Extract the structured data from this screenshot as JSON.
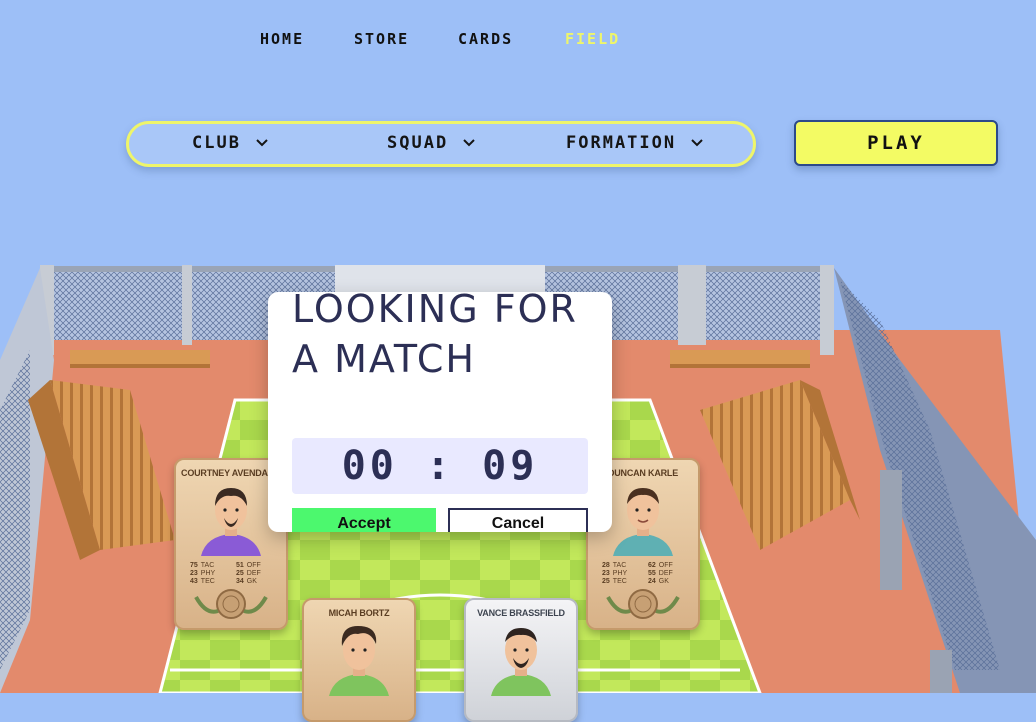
{
  "nav": {
    "items": [
      {
        "label": "HOME",
        "active": false
      },
      {
        "label": "STORE",
        "active": false
      },
      {
        "label": "CARDS",
        "active": false
      },
      {
        "label": "FIELD",
        "active": true
      }
    ]
  },
  "selectors": {
    "club": "CLUB",
    "squad": "SQUAD",
    "formation": "FORMATION"
  },
  "play_label": "PLAY",
  "modal": {
    "title": "LOOKING FOR A MATCH",
    "timer": "00 : 09",
    "accept_label": "Accept",
    "cancel_label": "Cancel"
  },
  "cards": [
    {
      "name": "COURTNEY AVENDANO",
      "tier": "bronze",
      "shirt": "#8a5bd6",
      "stats": [
        {
          "value": "75",
          "label": "TAC"
        },
        {
          "value": "51",
          "label": "OFF"
        },
        {
          "value": "23",
          "label": "PHY"
        },
        {
          "value": "25",
          "label": "DEF"
        },
        {
          "value": "43",
          "label": "TEC"
        },
        {
          "value": "34",
          "label": "GK"
        }
      ]
    },
    {
      "name": "DUNCAN KARLE",
      "tier": "bronze",
      "shirt": "#5fb0b3",
      "stats": [
        {
          "value": "28",
          "label": "TAC"
        },
        {
          "value": "62",
          "label": "OFF"
        },
        {
          "value": "23",
          "label": "PHY"
        },
        {
          "value": "55",
          "label": "DEF"
        },
        {
          "value": "25",
          "label": "TEC"
        },
        {
          "value": "24",
          "label": "GK"
        }
      ]
    },
    {
      "name": "MICAH BORTZ",
      "tier": "bronze",
      "shirt": "#7fc45e",
      "stats": []
    },
    {
      "name": "VANCE BRASSFIELD",
      "tier": "silver",
      "shirt": "#7fc45e",
      "stats": []
    }
  ],
  "colors": {
    "background": "#9dbff7",
    "accent_yellow": "#eef56a",
    "play_yellow": "#f3fb64",
    "accept_green": "#4cf86e",
    "modal_text": "#2c2f55",
    "timer_bg": "#e9e9ff"
  }
}
